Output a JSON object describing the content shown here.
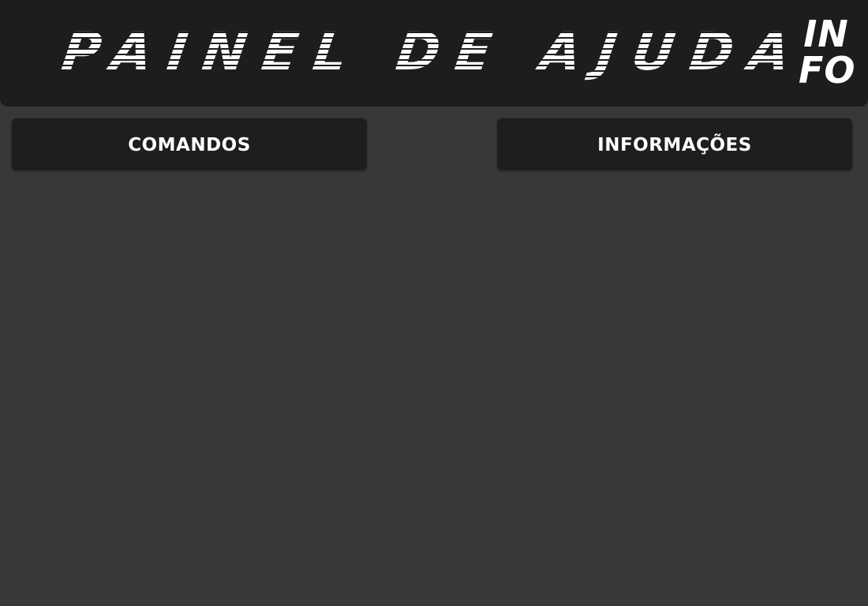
{
  "header": {
    "title": "PAINEL DE AJUDA",
    "logo_line1": "IN",
    "logo_line2": "FO"
  },
  "buttons": {
    "commands_label": "COMANDOS",
    "info_label": "INFORMAÇÕES"
  },
  "colors": {
    "background": "#383838",
    "header": "#1d1d1d",
    "button": "#1e1e1e",
    "text": "#ffffff"
  }
}
